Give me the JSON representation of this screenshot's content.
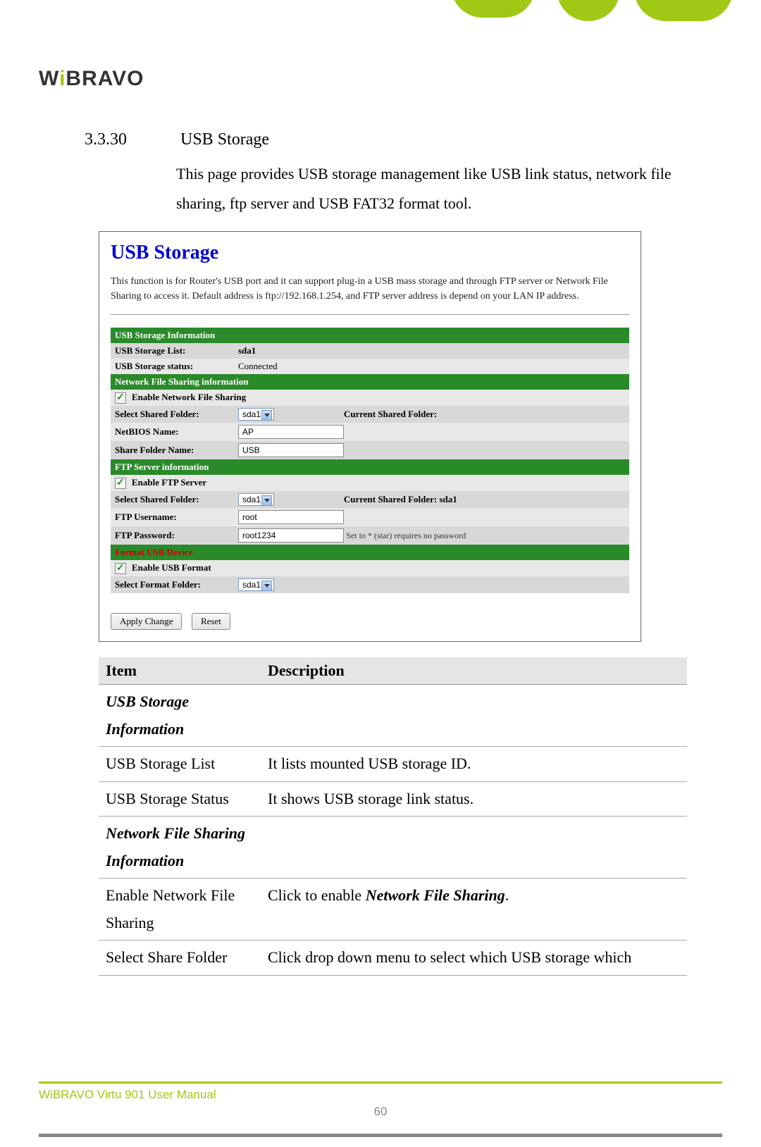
{
  "logo": {
    "prefix": "W",
    "accent": "i",
    "rest": "BRAVO"
  },
  "section": {
    "number": "3.3.30",
    "title": "USB Storage"
  },
  "section_desc": "This page provides USB storage management like USB link status, network file sharing, ftp server and USB FAT32 format tool.",
  "screenshot": {
    "title": "USB Storage",
    "intro": "This function is for Router's USB port and it can support plug-in a USB mass storage and through FTP server or Network File Sharing to access it. Default address is ftp://192.168.1.254, and FTP server address is depend on your LAN IP address.",
    "sec1": {
      "header": "USB Storage Information",
      "row1_label": "USB Storage List:",
      "row1_val": "sda1",
      "row2_label": "USB Storage status:",
      "row2_val": "Connected"
    },
    "sec2": {
      "header": "Network File Sharing information",
      "enable_label": "Enable Network File Sharing",
      "row1_label": "Select Shared Folder:",
      "row1_sel": "sda1",
      "row1_cur": "Current Shared Folder:",
      "row2_label": "NetBIOS Name:",
      "row2_val": "AP",
      "row3_label": "Share Folder Name:",
      "row3_val": "USB"
    },
    "sec3": {
      "header": "FTP Server information",
      "enable_label": "Enable FTP Server",
      "row1_label": "Select Shared Folder:",
      "row1_sel": "sda1",
      "row1_cur": "Current Shared Folder:  sda1",
      "row2_label": "FTP Username:",
      "row2_val": "root",
      "row3_label": "FTP Password:",
      "row3_val": "root1234",
      "row3_hint": "Set to * (star) requires no password"
    },
    "sec4": {
      "header": "Format USB Device",
      "enable_label": "Enable USB Format",
      "row1_label": "Select Format Folder:",
      "row1_sel": "sda1"
    },
    "btn_apply": "Apply Change",
    "btn_reset": "Reset"
  },
  "table": {
    "head_item": "Item",
    "head_desc": "Description",
    "r1_item": "USB Storage Information",
    "r2_item": "USB Storage List",
    "r2_desc": "It lists mounted USB storage ID.",
    "r3_item": "USB Storage Status",
    "r3_desc": "It shows USB storage link status.",
    "r4_item": "Network File Sharing Information",
    "r5_item": "Enable Network File Sharing",
    "r5_desc_pre": "Click to enable ",
    "r5_desc_em": "Network File Sharing",
    "r5_desc_post": ".",
    "r6_item": "Select Share Folder",
    "r6_desc": "Click drop down menu to select which USB storage which"
  },
  "footer": {
    "text": "WiBRAVO Virtu 901 User Manual",
    "page": "60"
  }
}
